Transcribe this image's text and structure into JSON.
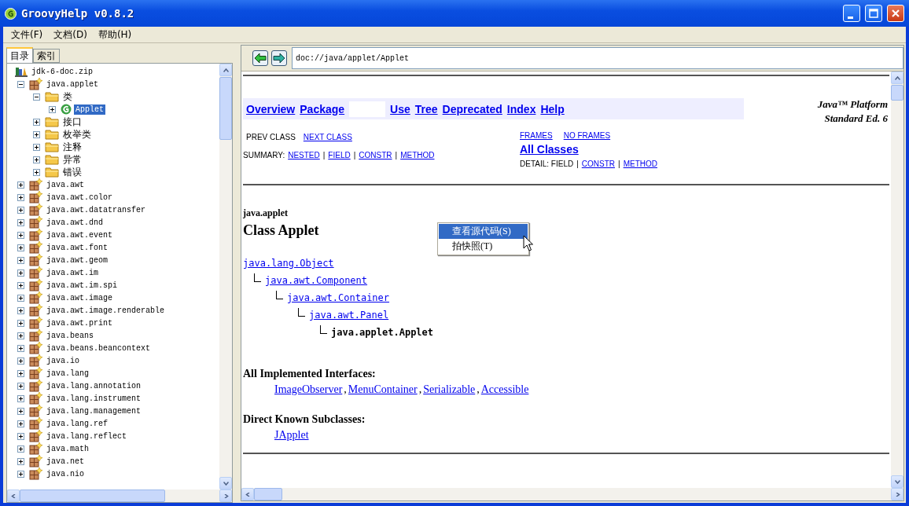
{
  "window": {
    "title": "GroovyHelp v0.8.2"
  },
  "menu": [
    "文件(F)",
    "文档(D)",
    "帮助(H)"
  ],
  "sidebar": {
    "tabs": [
      {
        "label": "目录",
        "selected": true
      },
      {
        "label": "索引",
        "selected": false
      }
    ],
    "tree": [
      {
        "label": "jdk-6-doc.zip",
        "kind": "archive",
        "children": [
          {
            "label": "java.applet",
            "kind": "package",
            "expanded": true,
            "selected": false,
            "children": [
              {
                "label": "类",
                "kind": "folder",
                "expanded": true,
                "selected": false,
                "children": [
                  {
                    "label": "Applet",
                    "kind": "class",
                    "expanded": false,
                    "selected": true
                  }
                ]
              },
              {
                "label": "接口",
                "kind": "folder",
                "expanded": false,
                "selected": false
              },
              {
                "label": "枚举类",
                "kind": "folder",
                "expanded": false,
                "selected": false
              },
              {
                "label": "注释",
                "kind": "folder",
                "expanded": false,
                "selected": false
              },
              {
                "label": "异常",
                "kind": "folder",
                "expanded": false,
                "selected": false
              },
              {
                "label": "错误",
                "kind": "folder",
                "expanded": false,
                "selected": false
              }
            ]
          },
          {
            "label": "java.awt",
            "kind": "package",
            "expanded": false,
            "selected": false
          },
          {
            "label": "java.awt.color",
            "kind": "package",
            "expanded": false,
            "selected": false
          },
          {
            "label": "java.awt.datatransfer",
            "kind": "package",
            "expanded": false,
            "selected": false
          },
          {
            "label": "java.awt.dnd",
            "kind": "package",
            "expanded": false,
            "selected": false
          },
          {
            "label": "java.awt.event",
            "kind": "package",
            "expanded": false,
            "selected": false
          },
          {
            "label": "java.awt.font",
            "kind": "package",
            "expanded": false,
            "selected": false
          },
          {
            "label": "java.awt.geom",
            "kind": "package",
            "expanded": false,
            "selected": false
          },
          {
            "label": "java.awt.im",
            "kind": "package",
            "expanded": false,
            "selected": false
          },
          {
            "label": "java.awt.im.spi",
            "kind": "package",
            "expanded": false,
            "selected": false
          },
          {
            "label": "java.awt.image",
            "kind": "package",
            "expanded": false,
            "selected": false
          },
          {
            "label": "java.awt.image.renderable",
            "kind": "package",
            "expanded": false,
            "selected": false
          },
          {
            "label": "java.awt.print",
            "kind": "package",
            "expanded": false,
            "selected": false
          },
          {
            "label": "java.beans",
            "kind": "package",
            "expanded": false,
            "selected": false
          },
          {
            "label": "java.beans.beancontext",
            "kind": "package",
            "expanded": false,
            "selected": false
          },
          {
            "label": "java.io",
            "kind": "package",
            "expanded": false,
            "selected": false
          },
          {
            "label": "java.lang",
            "kind": "package",
            "expanded": false,
            "selected": false
          },
          {
            "label": "java.lang.annotation",
            "kind": "package",
            "expanded": false,
            "selected": false
          },
          {
            "label": "java.lang.instrument",
            "kind": "package",
            "expanded": false,
            "selected": false
          },
          {
            "label": "java.lang.management",
            "kind": "package",
            "expanded": false,
            "selected": false
          },
          {
            "label": "java.lang.ref",
            "kind": "package",
            "expanded": false,
            "selected": false
          },
          {
            "label": "java.lang.reflect",
            "kind": "package",
            "expanded": false,
            "selected": false
          },
          {
            "label": "java.math",
            "kind": "package",
            "expanded": false,
            "selected": false
          },
          {
            "label": "java.net",
            "kind": "package",
            "expanded": false,
            "selected": false
          },
          {
            "label": "java.nio",
            "kind": "package",
            "expanded": false,
            "selected": false
          }
        ]
      }
    ]
  },
  "address": {
    "value": "doc://java/applet/Applet"
  },
  "doc": {
    "navbar": [
      {
        "label": "Overview",
        "kind": "link"
      },
      {
        "label": "Package",
        "kind": "link"
      },
      {
        "kind": "blank"
      },
      {
        "label": "Use",
        "kind": "link"
      },
      {
        "label": "Tree",
        "kind": "link"
      },
      {
        "label": "Deprecated",
        "kind": "link"
      },
      {
        "label": "Index",
        "kind": "link"
      },
      {
        "label": "Help",
        "kind": "link"
      }
    ],
    "platform": [
      "Java™ Platform",
      "Standard Ed. 6"
    ],
    "class_nav": [
      {
        "text": "PREV CLASS",
        "kind": "plain"
      },
      {
        "text": "NEXT CLASS",
        "kind": "link"
      }
    ],
    "frames": [
      {
        "text": "FRAMES",
        "kind": "link"
      },
      {
        "text": "NO FRAMES",
        "kind": "link"
      }
    ],
    "all_classes": "All Classes",
    "summary": [
      {
        "text": "SUMMARY:",
        "kind": "plain"
      },
      {
        "text": "NESTED",
        "kind": "link"
      },
      {
        "text": "|",
        "kind": "plain"
      },
      {
        "text": "FIELD",
        "kind": "link"
      },
      {
        "text": "|",
        "kind": "plain"
      },
      {
        "text": "CONSTR",
        "kind": "link"
      },
      {
        "text": "|",
        "kind": "plain"
      },
      {
        "text": "METHOD",
        "kind": "link"
      }
    ],
    "detail": [
      {
        "text": "DETAIL: FIELD",
        "kind": "plain"
      },
      {
        "text": "|",
        "kind": "plain"
      },
      {
        "text": "CONSTR",
        "kind": "link"
      },
      {
        "text": "|",
        "kind": "plain"
      },
      {
        "text": "METHOD",
        "kind": "link"
      }
    ],
    "package": "java.applet",
    "title": "Class Applet",
    "hierarchy": {
      "label": "java.lang.Object",
      "link": true,
      "children": [
        {
          "label": "java.awt.Component",
          "link": true,
          "children": [
            {
              "label": "java.awt.Container",
              "link": true,
              "children": [
                {
                  "label": "java.awt.Panel",
                  "link": true,
                  "children": [
                    {
                      "label": "java.applet.Applet",
                      "link": false
                    }
                  ]
                }
              ]
            }
          ]
        }
      ]
    },
    "sections": [
      {
        "heading": "All Implemented Interfaces:",
        "separator": ",",
        "items": [
          "ImageObserver",
          "MenuContainer",
          "Serializable",
          "Accessible"
        ]
      },
      {
        "heading": "Direct Known Subclasses:",
        "items": [
          "JApplet"
        ]
      }
    ]
  },
  "context_menu": [
    {
      "label": "查看源代码(S)",
      "selected": true
    },
    {
      "label": "拍快照(T)",
      "selected": false
    }
  ]
}
